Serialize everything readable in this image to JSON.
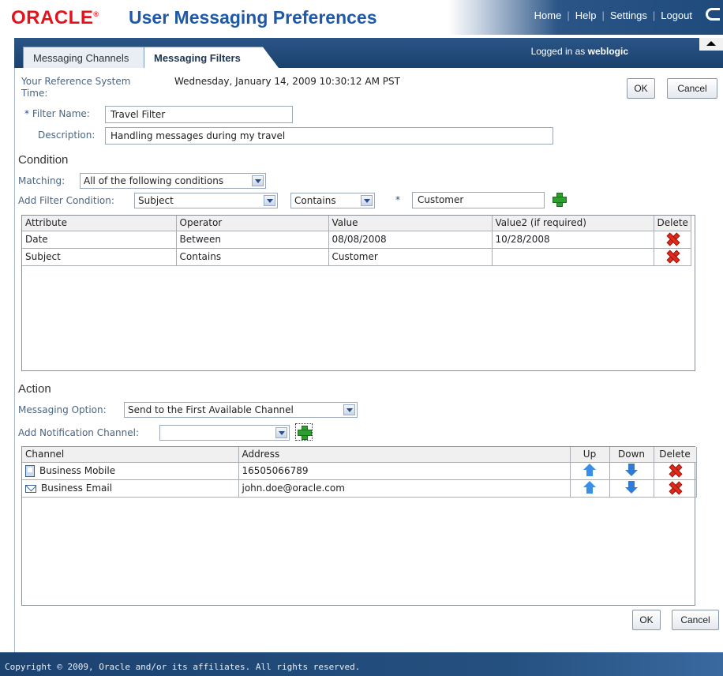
{
  "header": {
    "logo": "ORACLE",
    "app_title": "User Messaging Preferences",
    "nav": [
      "Home",
      "Help",
      "Settings",
      "Logout"
    ]
  },
  "tabs": [
    {
      "label": "Messaging Channels",
      "active": false
    },
    {
      "label": "Messaging Filters",
      "active": true
    }
  ],
  "login": {
    "prefix": "Logged in as",
    "user": "weblogic"
  },
  "form": {
    "ref_time_label": "Your Reference System Time:",
    "ref_time_value": "Wednesday, January 14, 2009 10:30:12 AM PST",
    "filter_name_label": "Filter Name:",
    "filter_name_value": "Travel Filter",
    "description_label": "Description:",
    "description_value": "Handling messages during my travel",
    "ok_label": "OK",
    "cancel_label": "Cancel"
  },
  "condition": {
    "title": "Condition",
    "matching_label": "Matching:",
    "matching_value": "All of the following conditions",
    "add_label": "Add Filter Condition:",
    "attribute_value": "Subject",
    "operator_value": "Contains",
    "value_value": "Customer",
    "columns": [
      "Attribute",
      "Operator",
      "Value",
      "Value2 (if required)",
      "Delete"
    ],
    "rows": [
      [
        "Date",
        "Between",
        "08/08/2008",
        "10/28/2008"
      ],
      [
        "Subject",
        "Contains",
        "Customer",
        ""
      ]
    ]
  },
  "action": {
    "title": "Action",
    "option_label": "Messaging Option:",
    "option_value": "Send to the First Available Channel",
    "add_channel_label": "Add Notification Channel:",
    "add_channel_value": "",
    "columns": [
      "Channel",
      "Address",
      "Up",
      "Down",
      "Delete"
    ],
    "rows": [
      {
        "channel": "Business Mobile",
        "icon": "mobile-icon",
        "address": "16505066789"
      },
      {
        "channel": "Business Email",
        "icon": "mail-icon",
        "address": "john.doe@oracle.com"
      }
    ]
  },
  "footer": {
    "text": "Copyright © 2009, Oracle and/or its affiliates. All rights reserved."
  },
  "colors": {
    "brand_red": "#e4131b",
    "title_blue": "#1e5aa8",
    "bar_navy": "#1f4a7c"
  }
}
